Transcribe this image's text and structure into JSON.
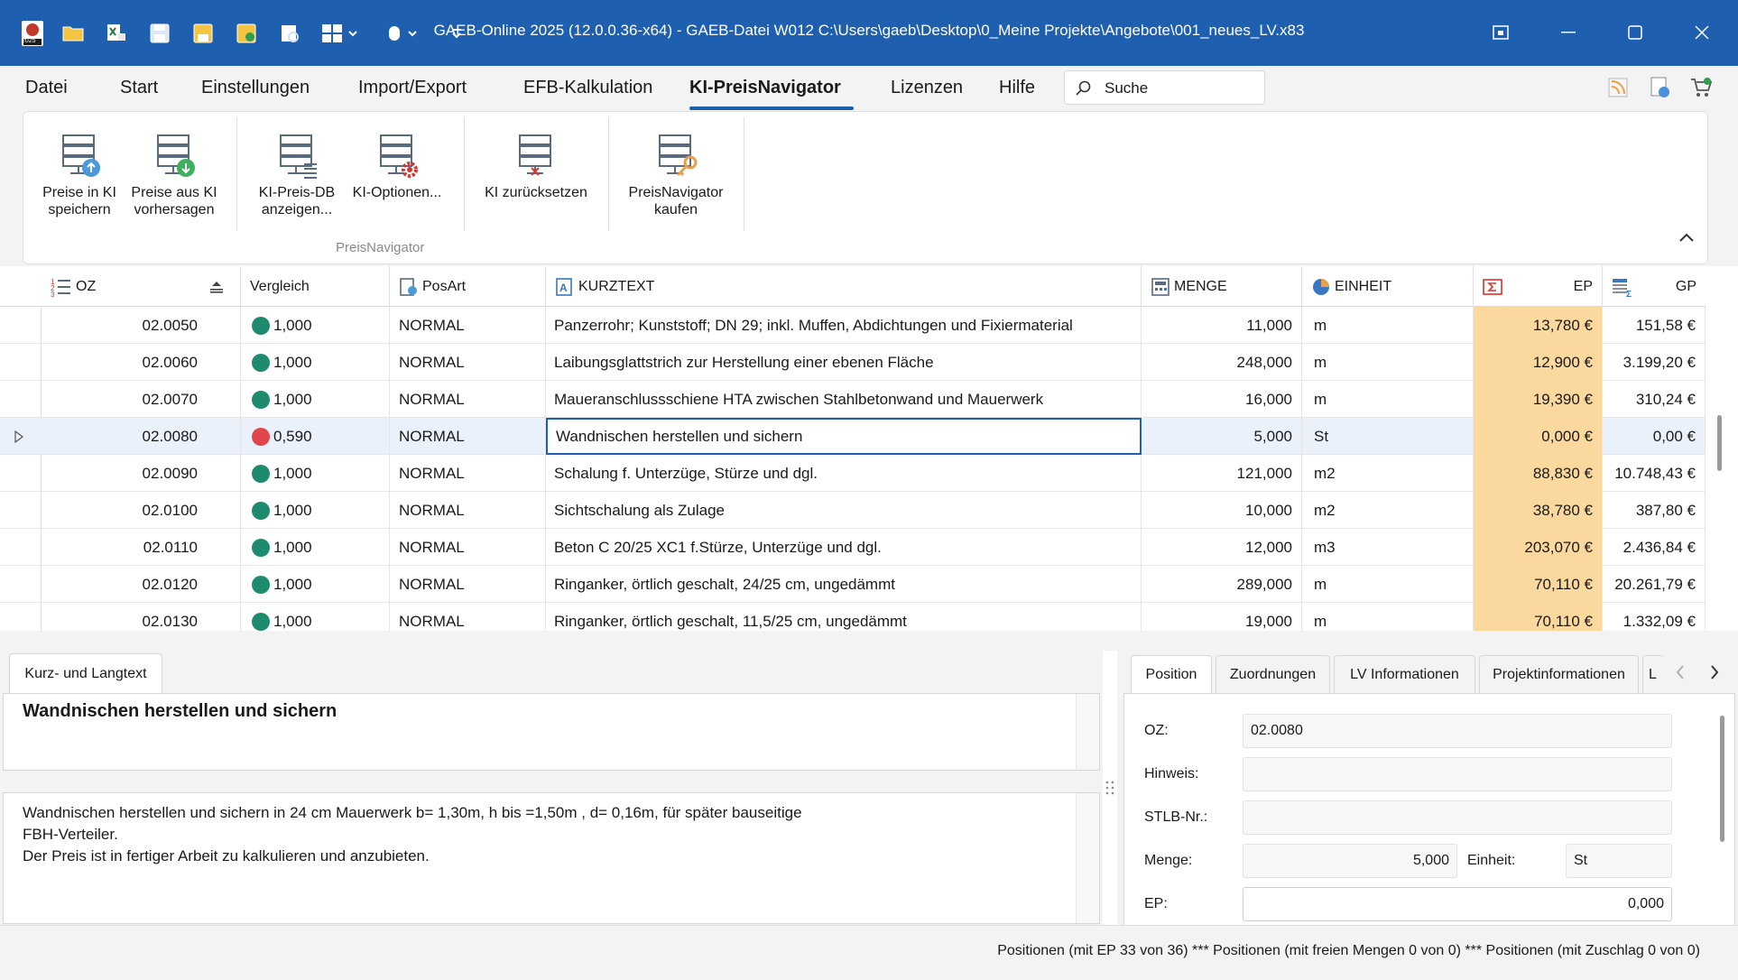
{
  "window": {
    "title": "GAEB-Online 2025 (12.0.0.36-x64) - GAEB-Datei  W012 C:\\Users\\gaeb\\Desktop\\0_Meine Projekte\\Angebote\\001_neues_LV.x83",
    "app_icon_label": "2025",
    "accent_color": "#1f5fb0"
  },
  "menu": {
    "items": [
      "Datei",
      "Start",
      "Einstellungen",
      "Import/Export",
      "EFB-Kalkulation",
      "KI-PreisNavigator",
      "Lizenzen",
      "Hilfe"
    ],
    "active": "KI-PreisNavigator",
    "search_placeholder": "Suche"
  },
  "ribbon": {
    "buttons": [
      {
        "label_line1": "Preise in KI",
        "label_line2": "speichern",
        "icon": "database-upload-icon"
      },
      {
        "label_line1": "Preise aus KI",
        "label_line2": "vorhersagen",
        "icon": "database-download-icon"
      },
      {
        "label_line1": "KI-Preis-DB",
        "label_line2": "anzeigen...",
        "icon": "database-list-icon"
      },
      {
        "label_line1": "KI-Optionen...",
        "label_line2": "",
        "icon": "database-settings-icon"
      },
      {
        "label_line1": "KI zurücksetzen",
        "label_line2": "",
        "icon": "database-reset-icon"
      },
      {
        "label_line1": "PreisNavigator",
        "label_line2": "kaufen",
        "icon": "database-key-icon"
      }
    ],
    "group_label": "PreisNavigator"
  },
  "grid": {
    "columns": [
      "OZ",
      "Vergleich",
      "PosArt",
      "KURZTEXT",
      "MENGE",
      "EINHEIT",
      "EP",
      "GP"
    ],
    "rows": [
      {
        "oz": "02.0050",
        "status": "green",
        "vergleich": "1,000",
        "posart": "NORMAL",
        "kurztext": "Panzerrohr; Kunststoff; DN 29; inkl. Muffen, Abdichtungen und Fixiermaterial",
        "menge": "11,000",
        "einheit": "m",
        "ep": "13,780 €",
        "gp": "151,58 €"
      },
      {
        "oz": "02.0060",
        "status": "green",
        "vergleich": "1,000",
        "posart": "NORMAL",
        "kurztext": "Laibungsglattstrich zur Herstellung einer ebenen Fläche",
        "menge": "248,000",
        "einheit": "m",
        "ep": "12,900 €",
        "gp": "3.199,20 €"
      },
      {
        "oz": "02.0070",
        "status": "green",
        "vergleich": "1,000",
        "posart": "NORMAL",
        "kurztext": "Maueranschlussschiene HTA zwischen Stahlbetonwand und Mauerwerk",
        "menge": "16,000",
        "einheit": "m",
        "ep": "19,390 €",
        "gp": "310,24 €"
      },
      {
        "oz": "02.0080",
        "status": "red",
        "vergleich": "0,590",
        "posart": "NORMAL",
        "kurztext": "Wandnischen herstellen und sichern",
        "menge": "5,000",
        "einheit": "St",
        "ep": "0,000 €",
        "gp": "0,00 €",
        "selected": true
      },
      {
        "oz": "02.0090",
        "status": "green",
        "vergleich": "1,000",
        "posart": "NORMAL",
        "kurztext": "Schalung f. Unterzüge, Stürze und dgl.",
        "menge": "121,000",
        "einheit": "m2",
        "ep": "88,830 €",
        "gp": "10.748,43 €"
      },
      {
        "oz": "02.0100",
        "status": "green",
        "vergleich": "1,000",
        "posart": "NORMAL",
        "kurztext": "Sichtschalung als Zulage",
        "menge": "10,000",
        "einheit": "m2",
        "ep": "38,780 €",
        "gp": "387,80 €"
      },
      {
        "oz": "02.0110",
        "status": "green",
        "vergleich": "1,000",
        "posart": "NORMAL",
        "kurztext": "Beton C 20/25 XC1 f.Stürze, Unterzüge und dgl.",
        "menge": "12,000",
        "einheit": "m3",
        "ep": "203,070 €",
        "gp": "2.436,84 €"
      },
      {
        "oz": "02.0120",
        "status": "green",
        "vergleich": "1,000",
        "posart": "NORMAL",
        "kurztext": "Ringanker, örtlich geschalt, 24/25 cm, ungedämmt",
        "menge": "289,000",
        "einheit": "m",
        "ep": "70,110 €",
        "gp": "20.261,79 €"
      },
      {
        "oz": "02.0130",
        "status": "green",
        "vergleich": "1,000",
        "posart": "NORMAL",
        "kurztext": "Ringanker, örtlich geschalt, 11,5/25 cm, ungedämmt",
        "menge": "19,000",
        "einheit": "m",
        "ep": "70,110 €",
        "gp": "1.332,09 €"
      }
    ],
    "status_colors": {
      "green": "#1e8a6e",
      "red": "#e0474c"
    }
  },
  "text_panel": {
    "tab_label": "Kurz- und Langtext",
    "short_text": "Wandnischen herstellen und sichern",
    "long_text_lines": [
      "Wandnischen herstellen und sichern in 24 cm Mauerwerk b= 1,30m, h bis =1,50m , d= 0,16m, für später bauseitige",
      "FBH-Verteiler.",
      "Der Preis ist in fertiger Arbeit zu kalkulieren und anzubieten."
    ]
  },
  "detail_panel": {
    "tabs": [
      "Position",
      "Zuordnungen",
      "LV Informationen",
      "Projektinformationen",
      "L"
    ],
    "active_tab": "Position",
    "oz_label": "OZ:",
    "oz_value": "02.0080",
    "hinweis_label": "Hinweis:",
    "hinweis_value": "",
    "stlb_label": "STLB-Nr.:",
    "stlb_value": "",
    "menge_label": "Menge:",
    "menge_value": "5,000",
    "einheit_label": "Einheit:",
    "einheit_value": "St",
    "ep_label": "EP:",
    "ep_value": "0,000"
  },
  "status_bar": {
    "text": "Positionen (mit EP 33 von 36) *** Positionen (mit freien Mengen 0 von 0) *** Positionen (mit Zuschlag 0 von 0)"
  }
}
